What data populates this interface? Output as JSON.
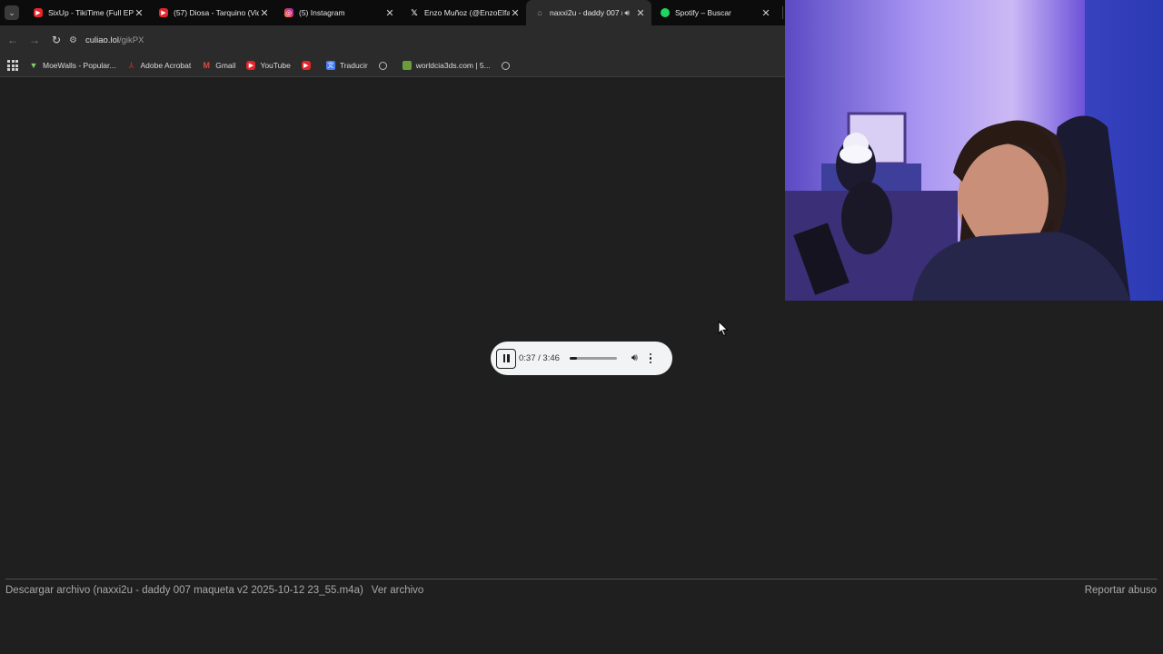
{
  "tabs": [
    {
      "title": "SixUp - TikiTime (Full EP)",
      "favicon": "youtube-icon",
      "active": false
    },
    {
      "title": "(57) Diosa - Tarquino (Vid",
      "favicon": "youtube-icon",
      "active": false
    },
    {
      "title": "(5) Instagram",
      "favicon": "instagram-icon",
      "active": false
    },
    {
      "title": "Enzo Muñoz (@EnzoElfac",
      "favicon": "x-icon",
      "active": false
    },
    {
      "title": "naxxi2u - daddy 007 m",
      "favicon": "document-icon",
      "active": true,
      "playing_audio": true
    },
    {
      "title": "Spotify – Buscar",
      "favicon": "spotify-icon",
      "active": false
    }
  ],
  "address": {
    "host": "culiao.lol",
    "path": "/gikPX"
  },
  "bookmarks": [
    {
      "label": "MoeWalls - Popular...",
      "icon": "moewalls-icon"
    },
    {
      "label": "Adobe Acrobat",
      "icon": "acrobat-icon"
    },
    {
      "label": "Gmail",
      "icon": "gmail-icon"
    },
    {
      "label": "YouTube",
      "icon": "youtube-icon"
    },
    {
      "label": "",
      "icon": "youtube-icon"
    },
    {
      "label": "Traducir",
      "icon": "translate-icon"
    },
    {
      "label": "",
      "icon": "globe-icon"
    },
    {
      "label": "worldcia3ds.com | 5...",
      "icon": "site-icon"
    },
    {
      "label": "",
      "icon": "globe-icon"
    }
  ],
  "player": {
    "time": "0:37 / 3:46",
    "state": "playing",
    "progress": 0.16
  },
  "footer": {
    "download": "Descargar archivo (naxxi2u - daddy 007 maqueta v2 2025-10-12 23_55.m4a)",
    "view": "Ver archivo",
    "report": "Reportar abuso"
  },
  "colors": {
    "page_bg": "#1f1f1f",
    "player_bg": "#f1f3f4",
    "youtube_red": "#e3262b",
    "spotify_green": "#1ed760"
  }
}
